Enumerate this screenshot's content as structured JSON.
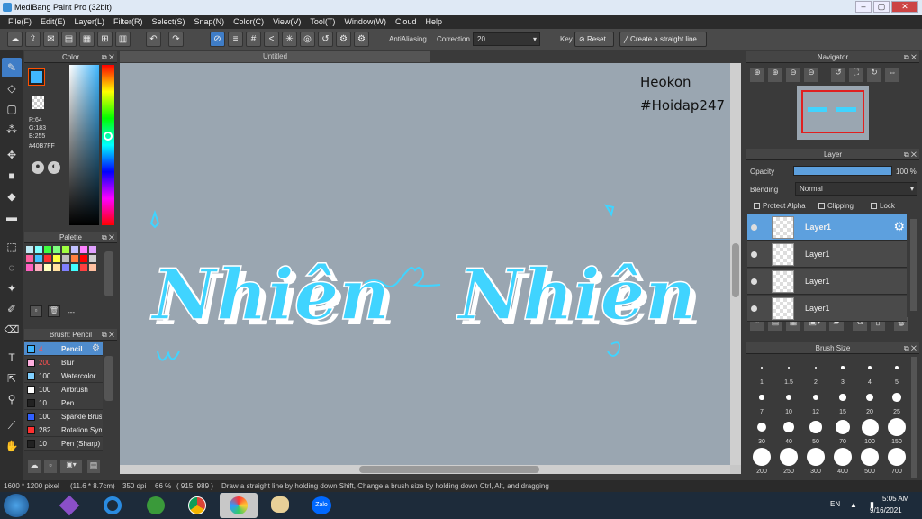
{
  "window": {
    "title": "MediBang Paint Pro (32bit)"
  },
  "menu": [
    "File(F)",
    "Edit(E)",
    "Layer(L)",
    "Filter(R)",
    "Select(S)",
    "Snap(N)",
    "Color(C)",
    "View(V)",
    "Tool(T)",
    "Window(W)",
    "Cloud",
    "Help"
  ],
  "toolbar": {
    "antialiasing": "AntiAliasing",
    "correction_label": "Correction",
    "correction_value": "20",
    "key_label": "Key",
    "reset_label": "Reset",
    "straight_line_label": "Create a straight line"
  },
  "color_panel": {
    "title": "Color",
    "r": "R:64",
    "g": "G:183",
    "b": "B:255",
    "hex": "#40B7FF",
    "accent": "#40B7FF"
  },
  "palette_panel": {
    "title": "Palette",
    "footer": "---",
    "colors": [
      "#bfeaf5",
      "#80ffff",
      "#40ff40",
      "#80ff80",
      "#a0ff40",
      "#c0c0ff",
      "#ff80ff",
      "#e0a0ff",
      "#ff60a0",
      "#40c0ff",
      "#ff3030",
      "#ffff40",
      "#c0c0c0",
      "#ff8040",
      "#ff0000",
      "#d0d0d0",
      "#ff60c0",
      "#ffb0c0",
      "#ffffc0",
      "#ffe0a0",
      "#8080ff",
      "#40ffff",
      "#ff4040",
      "#ffc0a0"
    ]
  },
  "brush_panel": {
    "title": "Brush: Pencil",
    "items": [
      {
        "size": "4",
        "name": "Pencil",
        "color": "#40B7FF"
      },
      {
        "size": "200",
        "name": "Blur",
        "color": "#ffb0e0"
      },
      {
        "size": "100",
        "name": "Watercolor",
        "color": "#80d0ff"
      },
      {
        "size": "100",
        "name": "Airbrush",
        "color": "#ffffff"
      },
      {
        "size": "10",
        "name": "Pen",
        "color": "#222222"
      },
      {
        "size": "100",
        "name": "Sparkle Brush",
        "color": "#3060ff"
      },
      {
        "size": "282",
        "name": "Rotation Sym",
        "color": "#ff3030"
      },
      {
        "size": "10",
        "name": "Pen (Sharp)",
        "color": "#222222"
      }
    ]
  },
  "document": {
    "tab": "Untitled"
  },
  "canvas": {
    "watermark_line1": "Heokon",
    "watermark_line2": "#Hoidap247",
    "word_left": "Nhiên",
    "word_right": "Nhiên"
  },
  "navigator": {
    "title": "Navigator"
  },
  "layer_panel": {
    "title": "Layer",
    "opacity_label": "Opacity",
    "opacity_value": "100 %",
    "opacity_fraction": 1.0,
    "blending_label": "Blending",
    "blending_value": "Normal",
    "protect_alpha": "Protect Alpha",
    "clipping": "Clipping",
    "lock": "Lock",
    "layers": [
      "Layer1",
      "Layer1",
      "Layer1",
      "Layer1"
    ]
  },
  "brush_size_panel": {
    "title": "Brush Size",
    "sizes": [
      "1",
      "1.5",
      "2",
      "3",
      "4",
      "5",
      "7",
      "10",
      "12",
      "15",
      "20",
      "25",
      "30",
      "40",
      "50",
      "70",
      "100",
      "150",
      "200",
      "250",
      "300",
      "400",
      "500",
      "700"
    ]
  },
  "status": {
    "size": "1600 * 1200 pixel",
    "cm": "(11.6 * 8.7cm)",
    "dpi": "350 dpi",
    "zoom": "66 %",
    "coords": "( 915, 989 )",
    "hint": "Draw a straight line by holding down Shift, Change a brush size by holding down Ctrl, Alt, and dragging"
  },
  "taskbar": {
    "lang": "EN",
    "time": "5:05 AM",
    "date": "9/16/2021",
    "zalo": "Zalo"
  }
}
